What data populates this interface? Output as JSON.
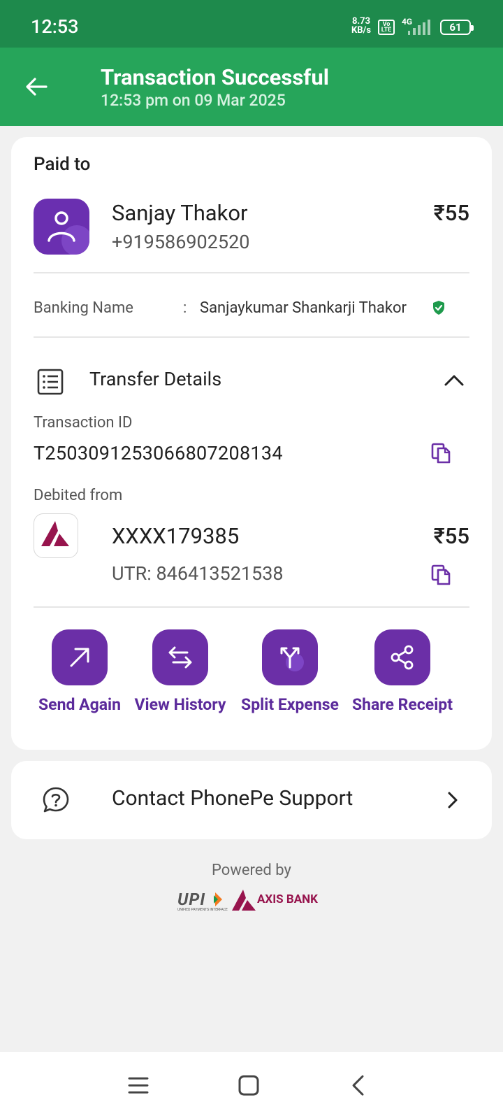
{
  "status_bar": {
    "time": "12:53",
    "net_speed_value": "8.73",
    "net_speed_unit": "KB/s",
    "volte": "Vo LTE",
    "network": "4G",
    "battery": "61"
  },
  "header": {
    "title": "Transaction Successful",
    "subtitle": "12:53 pm on 09 Mar 2025",
    "back_icon": "arrow-left-icon"
  },
  "payee": {
    "section_label": "Paid to",
    "name": "Sanjay Thakor",
    "phone": "+919586902520",
    "amount": "₹55",
    "banking_name_label": "Banking Name",
    "banking_name_sep": ":",
    "banking_name_value": "Sanjaykumar Shankarji Thakor"
  },
  "transfer_details": {
    "title": "Transfer Details",
    "transaction_id_label": "Transaction ID",
    "transaction_id": "T2503091253066807208134",
    "debited_label": "Debited from",
    "account": "XXXX179385",
    "account_amount": "₹55",
    "utr": "UTR: 846413521538"
  },
  "actions": [
    {
      "label": "Send Again",
      "icon": "arrow-up-right-icon"
    },
    {
      "label": "View History",
      "icon": "swap-arrows-icon"
    },
    {
      "label": "Split Expense",
      "icon": "split-icon"
    },
    {
      "label": "Share Receipt",
      "icon": "share-icon"
    }
  ],
  "support": {
    "label": "Contact PhonePe Support"
  },
  "footer": {
    "powered_by": "Powered by",
    "upi_logo_text": "UPI",
    "upi_subtext": "UNIFIED PAYMENTS INTERFACE",
    "bank_logo_text": "AXIS BANK"
  },
  "colors": {
    "status_bar": "#1e8a4c",
    "header": "#26a55a",
    "brand_purple": "#6b2fa7",
    "axis_maroon": "#97144d"
  }
}
